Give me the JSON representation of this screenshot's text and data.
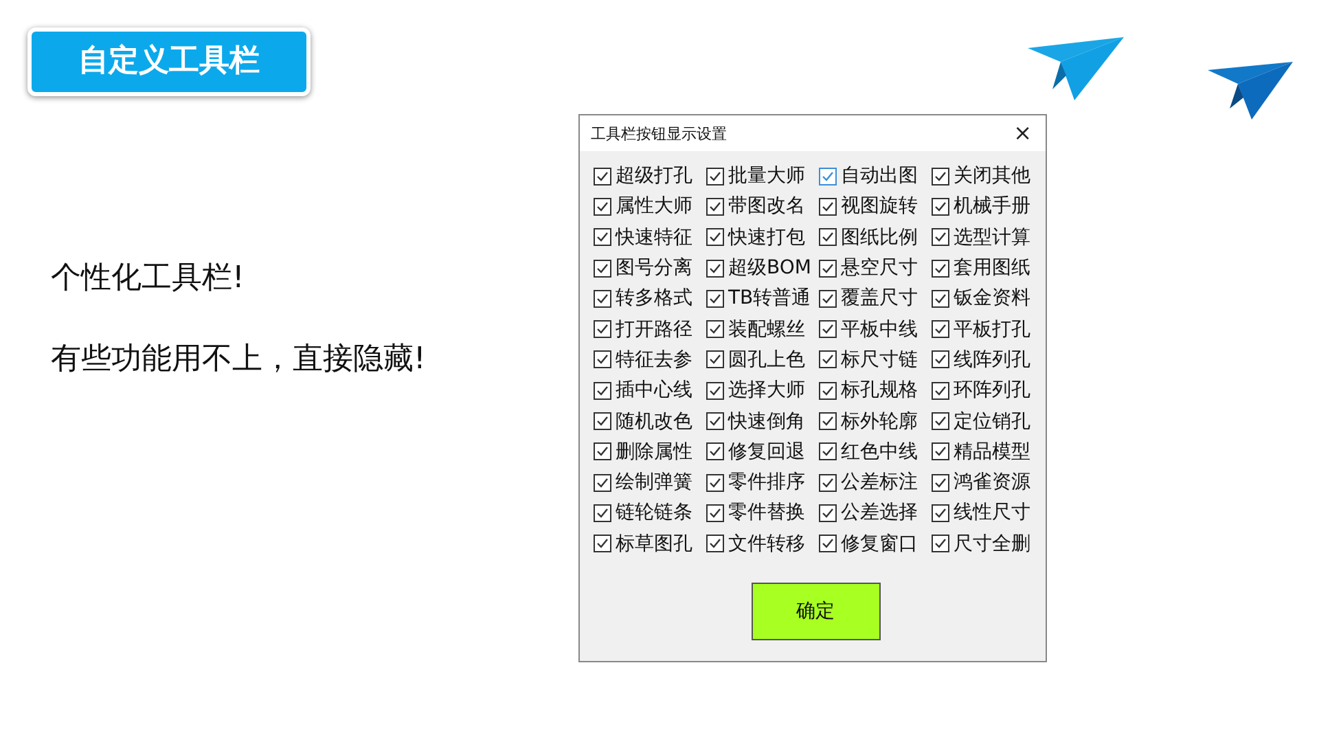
{
  "slide": {
    "title": "自定义工具栏",
    "lines": [
      "个性化工具栏!",
      "有些功能用不上，直接隐藏!"
    ]
  },
  "dialog": {
    "title": "工具栏按钮显示设置",
    "close": "×",
    "options": [
      {
        "label": "超级打孔",
        "checked": true,
        "focused": false
      },
      {
        "label": "批量大师",
        "checked": true,
        "focused": false
      },
      {
        "label": "自动出图",
        "checked": true,
        "focused": true
      },
      {
        "label": "关闭其他",
        "checked": true,
        "focused": false
      },
      {
        "label": "属性大师",
        "checked": true,
        "focused": false
      },
      {
        "label": "带图改名",
        "checked": true,
        "focused": false
      },
      {
        "label": "视图旋转",
        "checked": true,
        "focused": false
      },
      {
        "label": "机械手册",
        "checked": true,
        "focused": false
      },
      {
        "label": "快速特征",
        "checked": true,
        "focused": false
      },
      {
        "label": "快速打包",
        "checked": true,
        "focused": false
      },
      {
        "label": "图纸比例",
        "checked": true,
        "focused": false
      },
      {
        "label": "选型计算",
        "checked": true,
        "focused": false
      },
      {
        "label": "图号分离",
        "checked": true,
        "focused": false
      },
      {
        "label": "超级BOM",
        "checked": true,
        "focused": false
      },
      {
        "label": "悬空尺寸",
        "checked": true,
        "focused": false
      },
      {
        "label": "套用图纸",
        "checked": true,
        "focused": false
      },
      {
        "label": "转多格式",
        "checked": true,
        "focused": false
      },
      {
        "label": "TB转普通",
        "checked": true,
        "focused": false
      },
      {
        "label": "覆盖尺寸",
        "checked": true,
        "focused": false
      },
      {
        "label": "钣金资料",
        "checked": true,
        "focused": false
      },
      {
        "label": "打开路径",
        "checked": true,
        "focused": false
      },
      {
        "label": "装配螺丝",
        "checked": true,
        "focused": false
      },
      {
        "label": "平板中线",
        "checked": true,
        "focused": false
      },
      {
        "label": "平板打孔",
        "checked": true,
        "focused": false
      },
      {
        "label": "特征去参",
        "checked": true,
        "focused": false
      },
      {
        "label": "圆孔上色",
        "checked": true,
        "focused": false
      },
      {
        "label": "标尺寸链",
        "checked": true,
        "focused": false
      },
      {
        "label": "线阵列孔",
        "checked": true,
        "focused": false
      },
      {
        "label": "插中心线",
        "checked": true,
        "focused": false
      },
      {
        "label": "选择大师",
        "checked": true,
        "focused": false
      },
      {
        "label": "标孔规格",
        "checked": true,
        "focused": false
      },
      {
        "label": "环阵列孔",
        "checked": true,
        "focused": false
      },
      {
        "label": "随机改色",
        "checked": true,
        "focused": false
      },
      {
        "label": "快速倒角",
        "checked": true,
        "focused": false
      },
      {
        "label": "标外轮廓",
        "checked": true,
        "focused": false
      },
      {
        "label": "定位销孔",
        "checked": true,
        "focused": false
      },
      {
        "label": "删除属性",
        "checked": true,
        "focused": false
      },
      {
        "label": "修复回退",
        "checked": true,
        "focused": false
      },
      {
        "label": "红色中线",
        "checked": true,
        "focused": false
      },
      {
        "label": "精品模型",
        "checked": true,
        "focused": false
      },
      {
        "label": "绘制弹簧",
        "checked": true,
        "focused": false
      },
      {
        "label": "零件排序",
        "checked": true,
        "focused": false
      },
      {
        "label": "公差标注",
        "checked": true,
        "focused": false
      },
      {
        "label": "鸿雀资源",
        "checked": true,
        "focused": false
      },
      {
        "label": "链轮链条",
        "checked": true,
        "focused": false
      },
      {
        "label": "零件替换",
        "checked": true,
        "focused": false
      },
      {
        "label": "公差选择",
        "checked": true,
        "focused": false
      },
      {
        "label": "线性尺寸",
        "checked": true,
        "focused": false
      },
      {
        "label": "标草图孔",
        "checked": true,
        "focused": false
      },
      {
        "label": "文件转移",
        "checked": true,
        "focused": false
      },
      {
        "label": "修复窗口",
        "checked": true,
        "focused": false
      },
      {
        "label": "尺寸全删",
        "checked": true,
        "focused": false
      }
    ],
    "ok_button": "确定"
  }
}
